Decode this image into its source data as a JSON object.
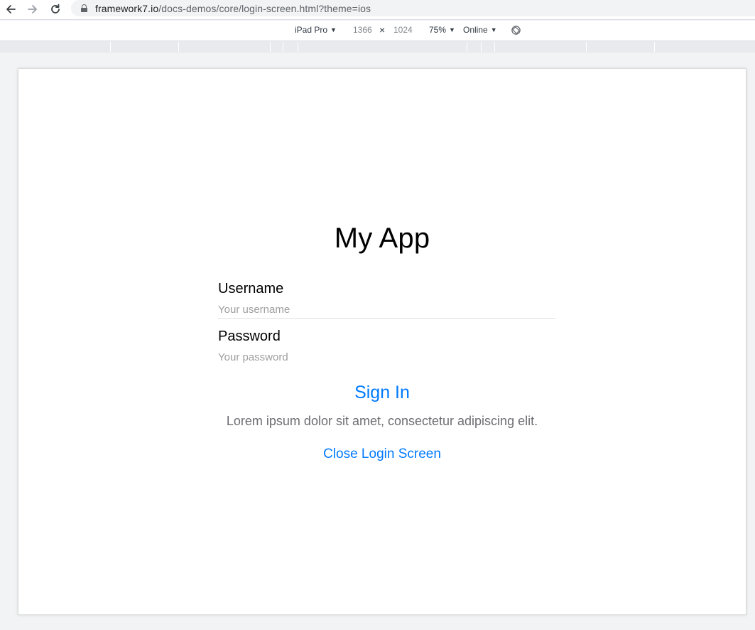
{
  "browser": {
    "url_host": "framework7.io",
    "url_path": "/docs-demos/core/login-screen.html?theme=ios"
  },
  "device_toolbar": {
    "device": "iPad Pro",
    "width": "1366",
    "height": "1024",
    "times": "×",
    "zoom": "75%",
    "network": "Online",
    "caret": "▼"
  },
  "login": {
    "title": "My App",
    "username_label": "Username",
    "username_placeholder": "Your username",
    "password_label": "Password",
    "password_placeholder": "Your password",
    "sign_in": "Sign In",
    "footer_text": "Lorem ipsum dolor sit amet, consectetur adipiscing elit.",
    "close_link": "Close Login Screen"
  },
  "colors": {
    "link": "#007aff",
    "footer_text": "#6d6d72",
    "placeholder": "#9e9e9e"
  }
}
